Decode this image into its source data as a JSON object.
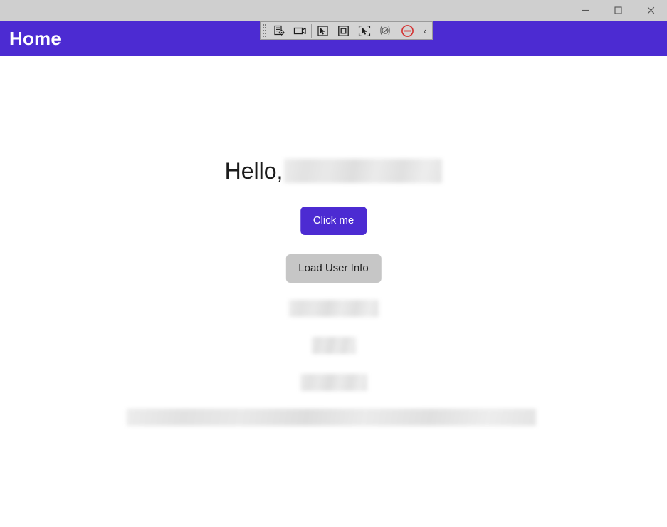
{
  "window": {
    "titlebar": {
      "minimize_label": "Minimize",
      "maximize_label": "Maximize",
      "close_label": "Close"
    }
  },
  "computer_use_toolbar": {
    "grip_label": "Drag toolbar",
    "collapse_label": "‹",
    "buttons": [
      {
        "id": "task-settings",
        "icon": "document-settings-icon",
        "label": "Task settings"
      },
      {
        "id": "record",
        "icon": "video-camera-icon",
        "label": "Record"
      },
      {
        "id": "select-element",
        "icon": "cursor-select-icon",
        "label": "Select element"
      },
      {
        "id": "select-region",
        "icon": "square-region-icon",
        "label": "Select region"
      },
      {
        "id": "capture-area",
        "icon": "cursor-capture-icon",
        "label": "Capture area"
      },
      {
        "id": "validate",
        "icon": "check-circle-icon",
        "label": "Validate"
      },
      {
        "id": "stop",
        "icon": "stop-circle-icon",
        "label": "Stop"
      }
    ]
  },
  "header": {
    "title": "Home"
  },
  "main": {
    "greeting_prefix": "Hello,",
    "greeting_name_redacted": true,
    "primary_button": "Click me",
    "secondary_button": "Load User Info",
    "redacted_lines": [
      {
        "id": "user-line-1",
        "redacted": true
      },
      {
        "id": "user-line-2",
        "redacted": true
      },
      {
        "id": "user-line-3",
        "redacted": true
      }
    ],
    "redacted_wide_line": {
      "id": "user-detail-wide",
      "redacted": true
    }
  },
  "colors": {
    "brand_purple": "#4c2bd2",
    "titlebar_gray": "#cfcfcf",
    "secondary_button_gray": "#c6c6c6",
    "stop_red": "#d32f2f",
    "page_background": "#ffffff"
  }
}
